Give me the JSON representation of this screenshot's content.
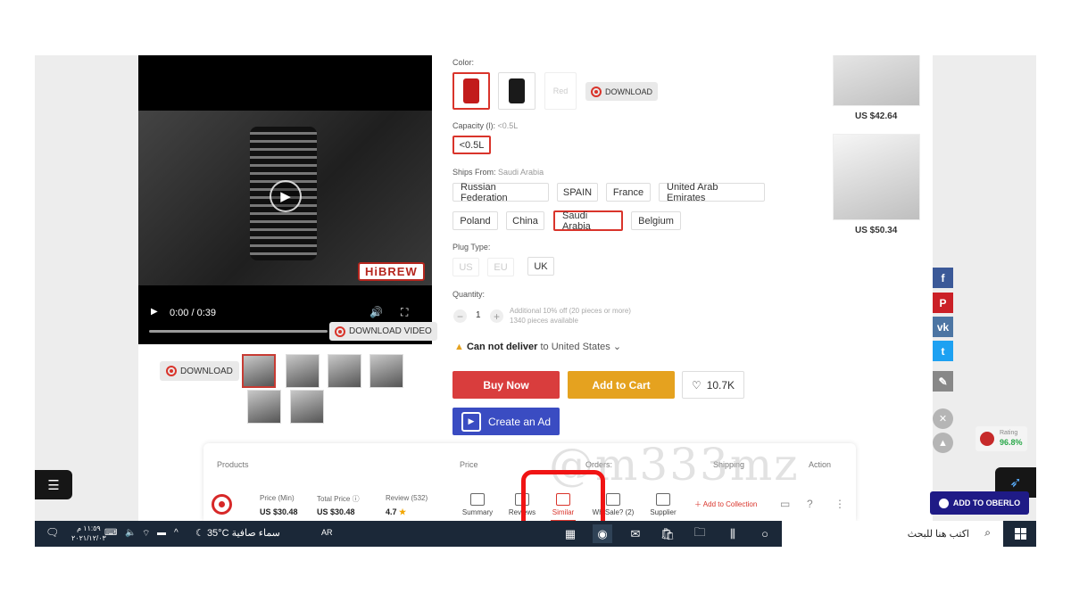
{
  "product": {
    "video": {
      "time": "0:00 / 0:39",
      "brand": "HiBREW",
      "download_video_label": "DOWNLOAD VIDEO"
    },
    "download_label": "DOWNLOAD",
    "color": {
      "label": "Color:",
      "options": [
        "Red",
        "Black",
        "Red"
      ],
      "download_label": "DOWNLOAD"
    },
    "capacity": {
      "label": "Capacity (l):",
      "value": "<0.5L",
      "option": "<0.5L"
    },
    "ships_from": {
      "label": "Ships From:",
      "value": "Saudi Arabia",
      "options": [
        "Russian Federation",
        "SPAIN",
        "France",
        "United Arab Emirates",
        "Poland",
        "China",
        "Saudi Arabia",
        "Belgium"
      ],
      "selected": "Saudi Arabia"
    },
    "plug": {
      "label": "Plug Type:",
      "options": [
        "US",
        "EU",
        "UK"
      ]
    },
    "quantity": {
      "label": "Quantity:",
      "value": "1",
      "note1": "Additional 10% off (20 pieces or more)",
      "note2": "1340 pieces available"
    },
    "delivery": {
      "bold": "Can not deliver",
      "rest": "to United States"
    },
    "buttons": {
      "buy": "Buy Now",
      "cart": "Add to Cart",
      "wishlist": "10.7K",
      "ad": "Create an Ad"
    }
  },
  "related": [
    {
      "price": "US $42.64"
    },
    {
      "price": "US $50.34"
    }
  ],
  "rating": {
    "label": "Rating",
    "value": "96.8%"
  },
  "oberlo_label": "ADD TO OBERLO",
  "panel": {
    "headers": {
      "products": "Products",
      "price": "Price",
      "orders": "Orders:",
      "shipping": "Shipping",
      "action": "Action"
    },
    "stats": [
      {
        "title": "Price (Min)",
        "value": "US $30.48"
      },
      {
        "title": "Total Price",
        "value": "US $30.48"
      },
      {
        "title": "Review (532)",
        "value": "4.7"
      }
    ],
    "actions": [
      "Summary",
      "Reviews",
      "Similar",
      "Wh Sale? (2)",
      "Supplier"
    ],
    "add_collection": "Add to Collection",
    "watermark": "@m333mz"
  },
  "taskbar": {
    "clock_time": "١١:٥٩ م",
    "clock_date": "٢٠٢١/١٢/٠٣",
    "weather_temp": "35°C",
    "weather_text": "سماء صافية",
    "lang": "AR",
    "search_placeholder": "اكتب هنا للبحث"
  },
  "colors": {
    "accent": "#d9342b",
    "buy": "#d93d3d",
    "cart": "#e5a21f",
    "ad": "#3a4cc2",
    "taskbar": "#1b2838"
  }
}
